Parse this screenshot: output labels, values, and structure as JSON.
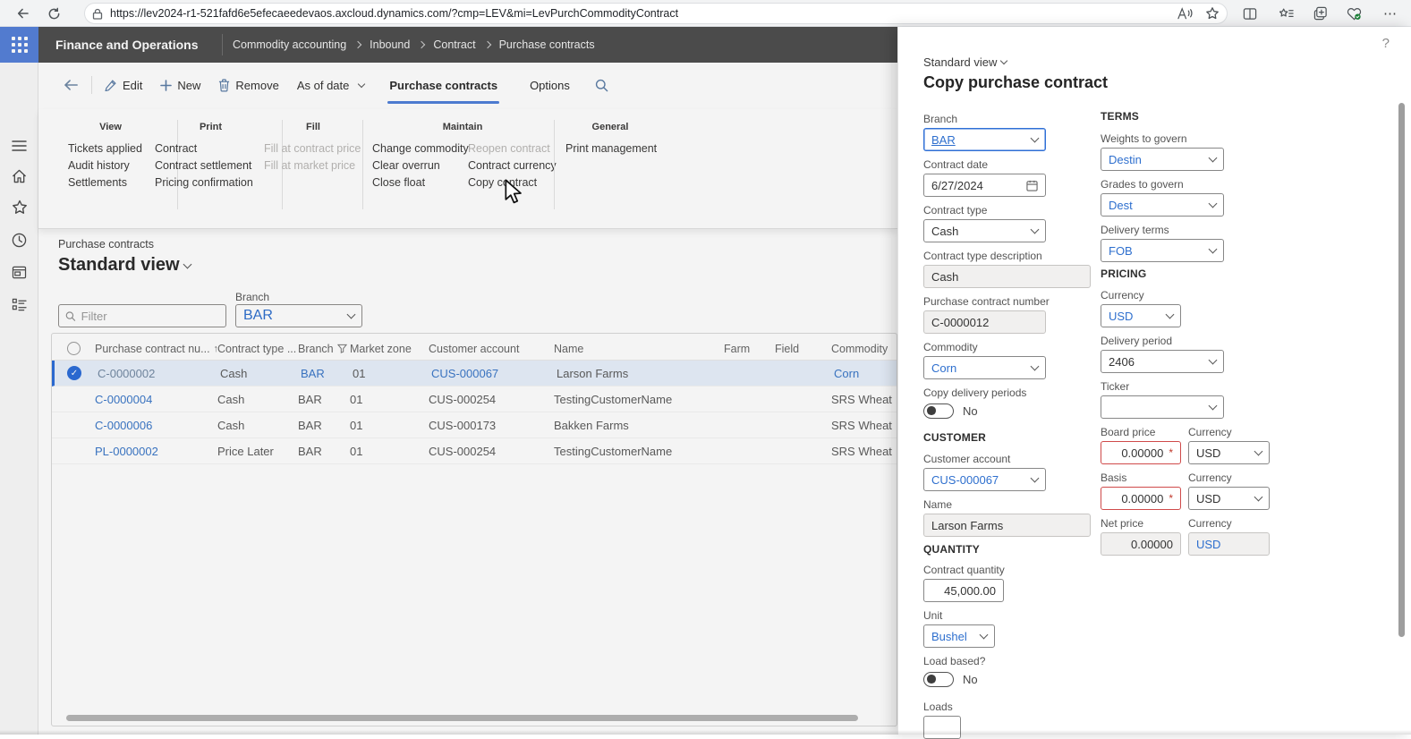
{
  "browser": {
    "url": "https://lev2024-r1-521fafd6e5efecaeedevaos.axcloud.dynamics.com/?cmp=LEV&mi=LevPurchCommodityContract"
  },
  "header": {
    "app_title": "Finance and Operations",
    "breadcrumb": [
      "Commodity accounting",
      "Inbound",
      "Contract",
      "Purchase contracts"
    ]
  },
  "action_pane": {
    "edit_label": "Edit",
    "new_label": "New",
    "remove_label": "Remove",
    "as_of_date_label": "As of date",
    "tab_purchase_contracts": "Purchase contracts",
    "tab_options": "Options"
  },
  "ribbon": {
    "view_label": "View",
    "view_items": [
      "Tickets applied",
      "Audit history",
      "Settlements"
    ],
    "print_label": "Print",
    "print_items": [
      "Contract",
      "Contract settlement",
      "Pricing confirmation"
    ],
    "fill_label": "Fill",
    "fill_items": [
      "Fill at contract price",
      "Fill at market price"
    ],
    "maintain_label": "Maintain",
    "maintain_col1": [
      "Change commodity",
      "Clear overrun",
      "Close float"
    ],
    "maintain_col2": [
      "Reopen contract",
      "Contract currency",
      "Copy contract"
    ],
    "general_label": "General",
    "general_items": [
      "Print management"
    ]
  },
  "list_page": {
    "caption": "Purchase contracts",
    "view_title": "Standard view",
    "filter_placeholder": "Filter",
    "branch_filter_label": "Branch",
    "branch_filter_value": "BAR"
  },
  "grid": {
    "columns": {
      "number": "Purchase contract nu...",
      "type": "Contract type ...",
      "branch": "Branch",
      "zone": "Market zone",
      "customer": "Customer account",
      "name": "Name",
      "farm": "Farm",
      "field": "Field",
      "commodity": "Commodity"
    },
    "rows": [
      {
        "number": "C-0000002",
        "type": "Cash",
        "branch": "BAR",
        "zone": "01",
        "customer": "CUS-000067",
        "name": "Larson Farms",
        "farm": "",
        "field": "",
        "commodity": "Corn"
      },
      {
        "number": "C-0000004",
        "type": "Cash",
        "branch": "BAR",
        "zone": "01",
        "customer": "CUS-000254",
        "name": "TestingCustomerName",
        "farm": "",
        "field": "",
        "commodity": "SRS Wheat"
      },
      {
        "number": "C-0000006",
        "type": "Cash",
        "branch": "BAR",
        "zone": "01",
        "customer": "CUS-000173",
        "name": "Bakken Farms",
        "farm": "",
        "field": "",
        "commodity": "SRS Wheat"
      },
      {
        "number": "PL-0000002",
        "type": "Price Later",
        "branch": "BAR",
        "zone": "01",
        "customer": "CUS-000254",
        "name": "TestingCustomerName",
        "farm": "",
        "field": "",
        "commodity": "SRS Wheat"
      }
    ]
  },
  "dialog": {
    "view_label": "Standard view",
    "title": "Copy purchase contract",
    "branch": {
      "label": "Branch",
      "value": "BAR"
    },
    "contract_date": {
      "label": "Contract date",
      "value": "6/27/2024"
    },
    "contract_type": {
      "label": "Contract type",
      "value": "Cash"
    },
    "contract_type_description": {
      "label": "Contract type description",
      "value": "Cash"
    },
    "purchase_contract_number": {
      "label": "Purchase contract number",
      "value": "C-0000012"
    },
    "commodity": {
      "label": "Commodity",
      "value": "Corn"
    },
    "copy_delivery_periods": {
      "label": "Copy delivery periods",
      "value": "No"
    },
    "customer_section": "CUSTOMER",
    "customer_account": {
      "label": "Customer account",
      "value": "CUS-000067"
    },
    "name": {
      "label": "Name",
      "value": "Larson Farms"
    },
    "quantity_section": "QUANTITY",
    "contract_quantity": {
      "label": "Contract quantity",
      "value": "45,000.00"
    },
    "unit": {
      "label": "Unit",
      "value": "Bushel"
    },
    "load_based": {
      "label": "Load based?",
      "value": "No"
    },
    "loads_label": "Loads",
    "terms_section": "TERMS",
    "weights_to_govern": {
      "label": "Weights to govern",
      "value": "Destin"
    },
    "grades_to_govern": {
      "label": "Grades to govern",
      "value": "Dest"
    },
    "delivery_terms": {
      "label": "Delivery terms",
      "value": "FOB"
    },
    "pricing_section": "PRICING",
    "currency": {
      "label": "Currency",
      "value": "USD"
    },
    "delivery_period": {
      "label": "Delivery period",
      "value": "2406"
    },
    "ticker": {
      "label": "Ticker",
      "value": ""
    },
    "board_price": {
      "label": "Board price",
      "value": "0.00000",
      "currency_label": "Currency",
      "currency_value": "USD"
    },
    "basis": {
      "label": "Basis",
      "value": "0.00000",
      "currency_label": "Currency",
      "currency_value": "USD"
    },
    "net_price": {
      "label": "Net price",
      "value": "0.00000",
      "currency_label": "Currency",
      "currency_value": "USD"
    }
  },
  "icons": {
    "help": "?",
    "overflow_dots": "⋯",
    "sort_ascending": "↑",
    "required": "*"
  },
  "colors": {
    "accent": "#2266E3",
    "link": "#3A77C8",
    "header_bar": "#4D4D4D",
    "app_launcher": "#5580D8",
    "selected_row": "#E7F0FB",
    "error_border": "#CF4A4A",
    "readonly_bg": "#F1F0EF"
  }
}
